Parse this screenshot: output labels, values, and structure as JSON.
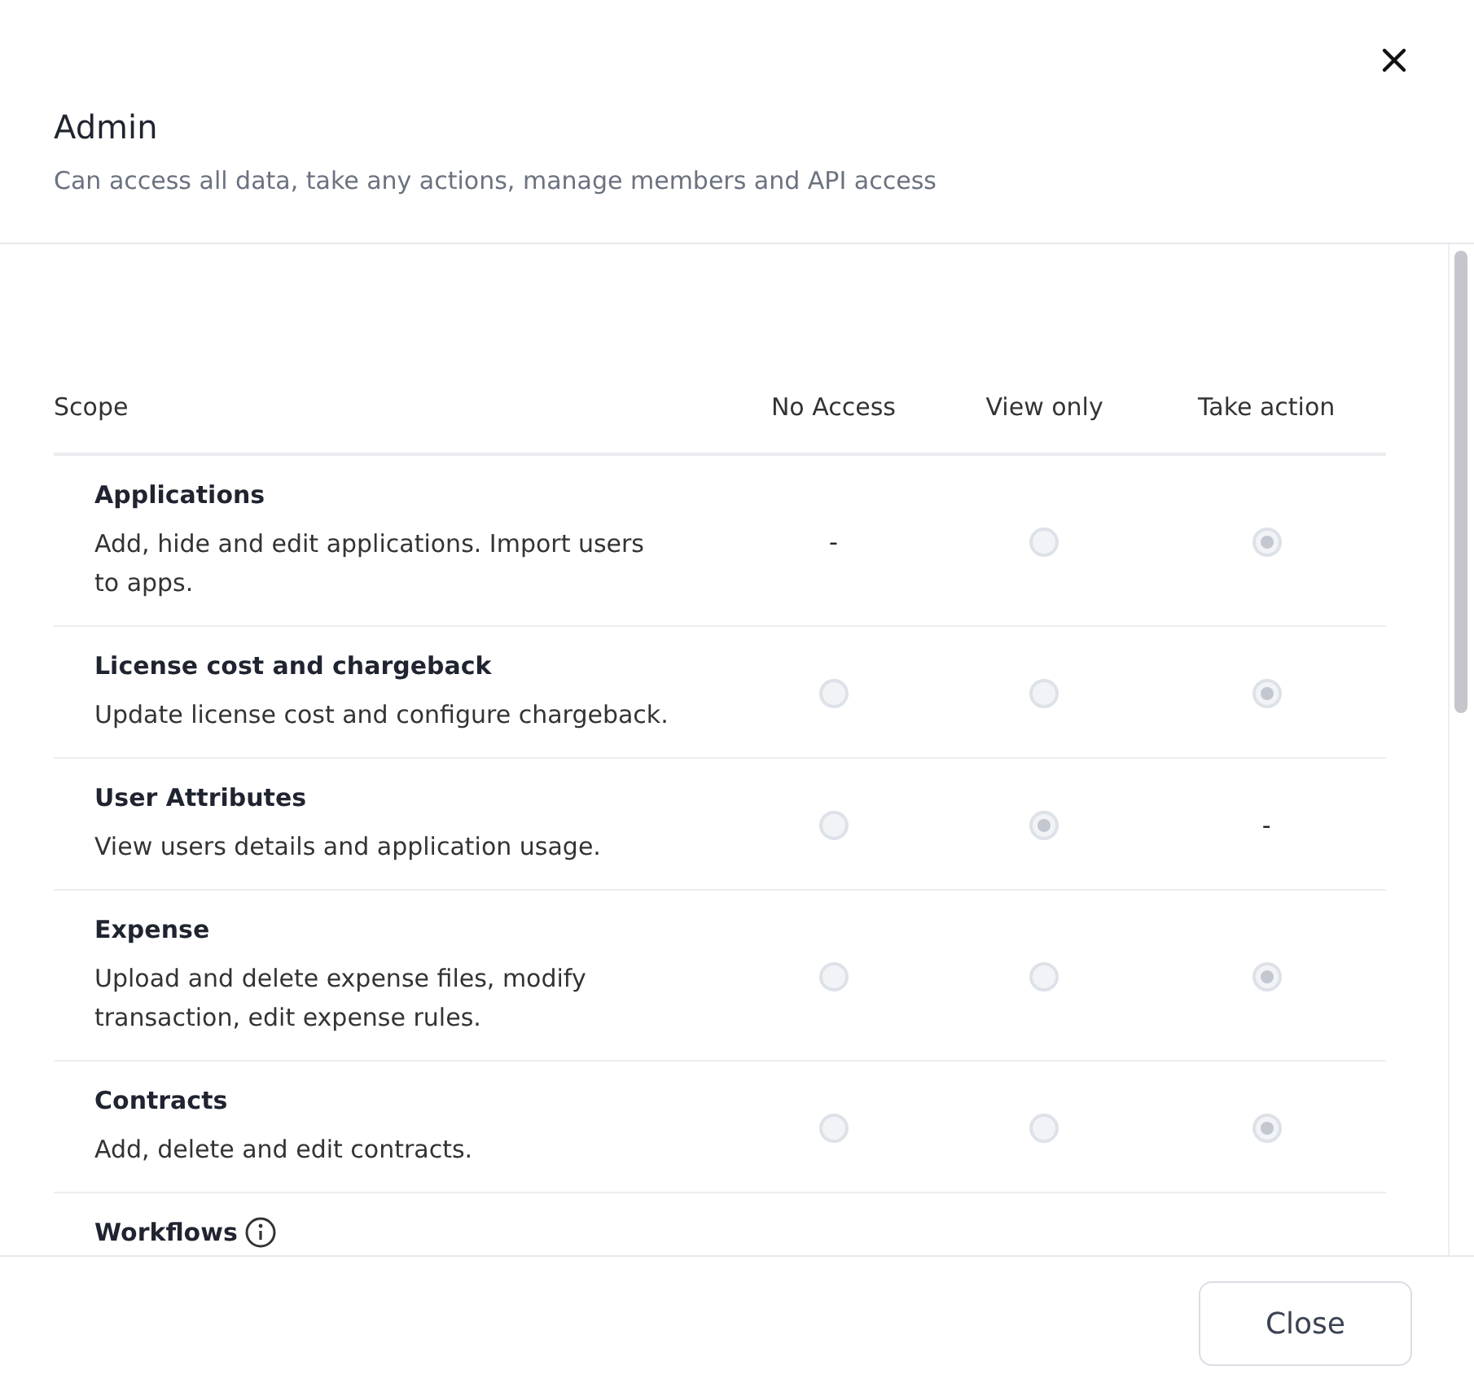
{
  "dialog": {
    "title": "Admin",
    "subtitle": "Can access all data, take any actions, manage members and API access"
  },
  "table": {
    "columns": [
      "Scope",
      "No Access",
      "View only",
      "Take action"
    ],
    "rows": [
      {
        "cells": [
          {
            "kind": "scope",
            "name": "Applications",
            "description": "Add, hide and edit applications. Import users to apps.",
            "info": false
          },
          {
            "kind": "dash",
            "text": "-"
          },
          {
            "kind": "radio",
            "selected": false
          },
          {
            "kind": "radio",
            "selected": true
          }
        ]
      },
      {
        "cells": [
          {
            "kind": "scope",
            "name": "License cost and chargeback",
            "description": "Update license cost and configure chargeback.",
            "info": false
          },
          {
            "kind": "radio",
            "selected": false
          },
          {
            "kind": "radio",
            "selected": false
          },
          {
            "kind": "radio",
            "selected": true
          }
        ]
      },
      {
        "cells": [
          {
            "kind": "scope",
            "name": "User Attributes",
            "description": "View users details and application usage.",
            "info": false
          },
          {
            "kind": "radio",
            "selected": false
          },
          {
            "kind": "radio",
            "selected": true
          },
          {
            "kind": "dash",
            "text": "-"
          }
        ]
      },
      {
        "cells": [
          {
            "kind": "scope",
            "name": "Expense",
            "description": "Upload and delete expense files, modify transaction, edit expense rules.",
            "info": false
          },
          {
            "kind": "radio",
            "selected": false
          },
          {
            "kind": "radio",
            "selected": false
          },
          {
            "kind": "radio",
            "selected": true
          }
        ]
      },
      {
        "cells": [
          {
            "kind": "scope",
            "name": "Contracts",
            "description": "Add, delete and edit contracts.",
            "info": false
          },
          {
            "kind": "radio",
            "selected": false
          },
          {
            "kind": "radio",
            "selected": false
          },
          {
            "kind": "radio",
            "selected": true
          }
        ]
      },
      {
        "cells": [
          {
            "kind": "scope",
            "name": "Workflows",
            "info": true
          }
        ]
      }
    ]
  },
  "footer": {
    "button": "Close"
  }
}
